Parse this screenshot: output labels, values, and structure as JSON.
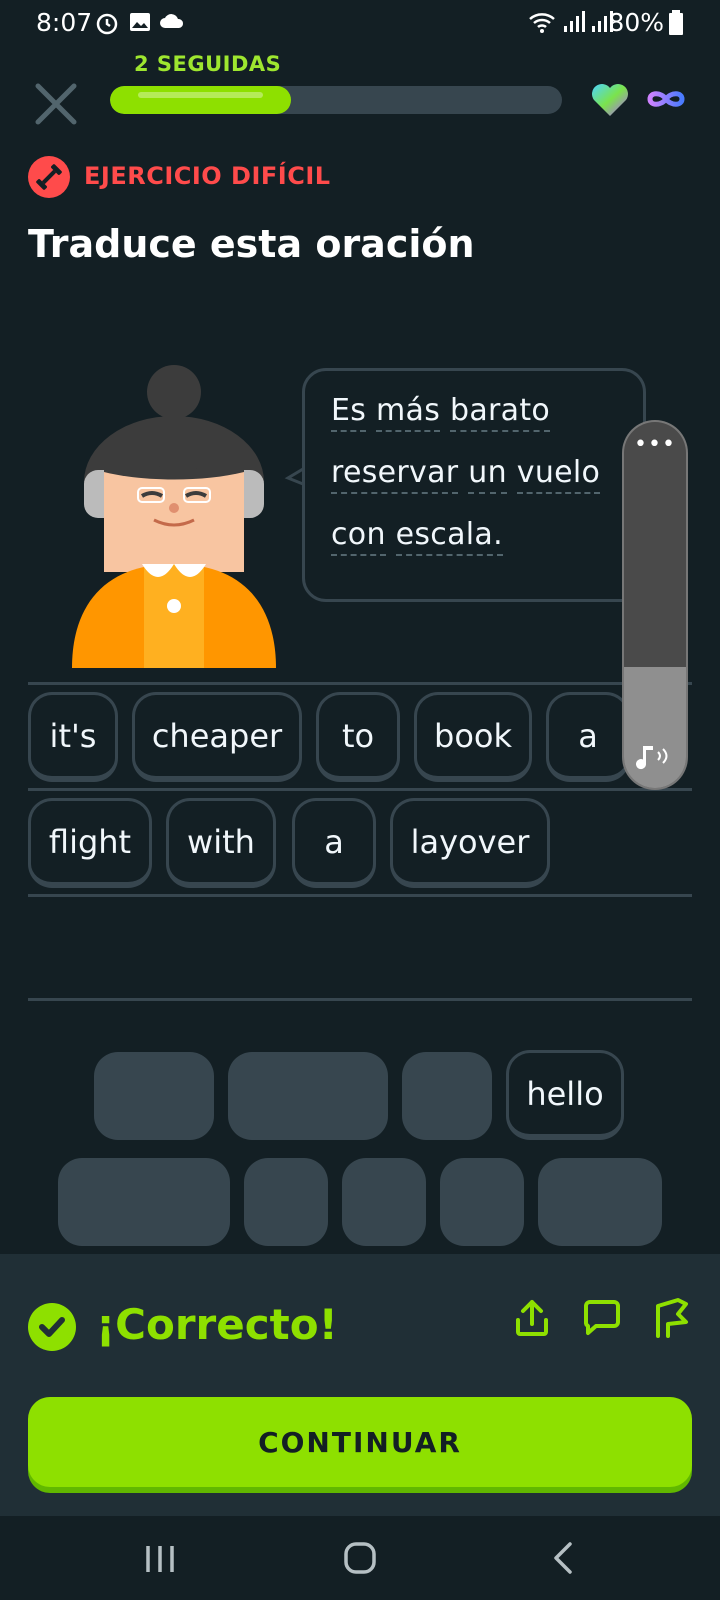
{
  "status_bar": {
    "time": "8:07",
    "battery": "80%"
  },
  "header": {
    "streak_label": "2 SEGUIDAS",
    "progress_percent": 40
  },
  "exercise": {
    "badge": "EJERCICIO DIFÍCIL",
    "title": "Traduce esta oración",
    "prompt_lines": [
      [
        "Es",
        "más",
        "barato"
      ],
      [
        "reservar",
        "un",
        "vuelo"
      ],
      [
        "con",
        "escala."
      ]
    ]
  },
  "volume": {
    "dots": "•••",
    "level_percent": 33
  },
  "answer": {
    "row1": [
      "it's",
      "cheaper",
      "to",
      "book",
      "a"
    ],
    "row2": [
      "flight",
      "with",
      "a",
      "layover"
    ]
  },
  "word_bank": {
    "remaining": [
      "hello"
    ]
  },
  "result": {
    "message": "¡Correcto!",
    "continue_label": "CONTINUAR"
  },
  "colors": {
    "background": "#131f24",
    "accent_green": "#8ee000",
    "danger_red": "#ff4b4b",
    "border": "#37464f"
  }
}
